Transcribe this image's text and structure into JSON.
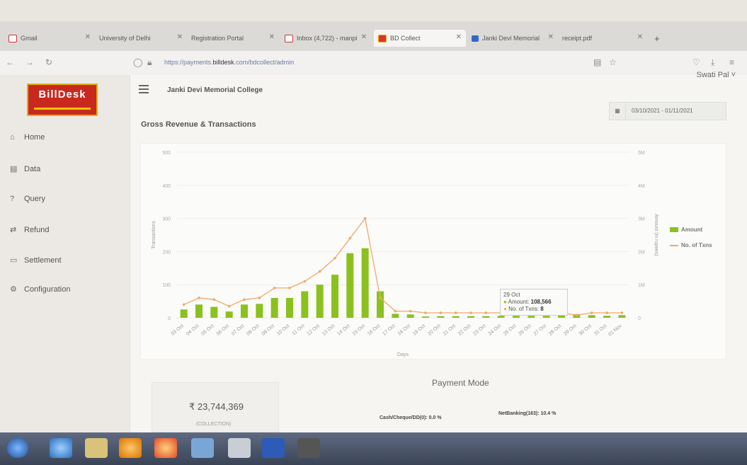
{
  "browser": {
    "tabs": [
      {
        "label": "Gmail",
        "active": false
      },
      {
        "label": "University of Delhi",
        "active": false
      },
      {
        "label": "Registration Portal",
        "active": false
      },
      {
        "label": "Inbox (4,722) - manpi",
        "active": false
      },
      {
        "label": "BD Collect",
        "active": true
      },
      {
        "label": "Janki Devi Memorial",
        "active": false
      },
      {
        "label": "receipt.pdf",
        "active": false
      }
    ],
    "url_prefix": "https://payments.",
    "url_domain": "billdesk",
    "url_suffix": ".com/bdcollect/admin"
  },
  "sidebar": {
    "logo_text": "BillDesk",
    "items": [
      {
        "label": "Home",
        "icon": "home-icon"
      },
      {
        "label": "Data",
        "icon": "document-icon"
      },
      {
        "label": "Query",
        "icon": "question-icon"
      },
      {
        "label": "Refund",
        "icon": "refund-arrows-icon"
      },
      {
        "label": "Settlement",
        "icon": "settlement-icon"
      },
      {
        "label": "Configuration",
        "icon": "gear-icon"
      }
    ]
  },
  "header": {
    "college": "Janki Devi Memorial College",
    "user": "Swati Pal ˅",
    "date_range": "03/10/2021 - 01/11/2021"
  },
  "section_title": "Gross Revenue & Transactions",
  "chart_data": {
    "type": "bar",
    "categories": [
      "03 Oct",
      "04 Oct",
      "05 Oct",
      "06 Oct",
      "07 Oct",
      "08 Oct",
      "09 Oct",
      "10 Oct",
      "11 Oct",
      "12 Oct",
      "13 Oct",
      "14 Oct",
      "15 Oct",
      "16 Oct",
      "17 Oct",
      "18 Oct",
      "19 Oct",
      "20 Oct",
      "21 Oct",
      "22 Oct",
      "23 Oct",
      "24 Oct",
      "25 Oct",
      "26 Oct",
      "27 Oct",
      "28 Oct",
      "29 Oct",
      "30 Oct",
      "31 Oct",
      "01 Nov"
    ],
    "series": [
      {
        "name": "Amount",
        "axis": "right",
        "values": [
          250000,
          400000,
          330000,
          190000,
          400000,
          420000,
          600000,
          600000,
          800000,
          1000000,
          1300000,
          1950000,
          2100000,
          800000,
          120000,
          100000,
          40000,
          50000,
          50000,
          50000,
          50000,
          60000,
          60000,
          60000,
          60000,
          70000,
          108566,
          80000,
          60000,
          80000
        ]
      },
      {
        "name": "No. of Txns",
        "axis": "left",
        "values": [
          40,
          60,
          55,
          35,
          55,
          60,
          90,
          90,
          110,
          140,
          180,
          240,
          300,
          60,
          20,
          20,
          15,
          15,
          15,
          15,
          15,
          15,
          15,
          15,
          15,
          15,
          8,
          15,
          15,
          15
        ]
      }
    ],
    "ylabel_left": "Transactions",
    "ylabel_right": "Amount (in rupees)",
    "xlabel": "Days",
    "ylim_left": [
      0,
      500
    ],
    "ylim_right": [
      0,
      5000000
    ],
    "yticks_left": [
      "0",
      "100",
      "200",
      "300",
      "400",
      "500"
    ],
    "yticks_right": [
      "0",
      "1M",
      "2M",
      "3M",
      "4M",
      "5M"
    ],
    "legend": "right",
    "colors": {
      "amount": "#8ac11e",
      "txns": "#f0a868"
    },
    "tooltip": {
      "date": "29 Oct",
      "amount_label": "Amount:",
      "amount": "108,566",
      "txns_label": "No. of Txns:",
      "txns": "8"
    }
  },
  "payment_mode": {
    "title": "Payment Mode",
    "collection_value": "₹ 23,744,369",
    "collection_label": "(COLLECTION)",
    "labels": [
      "Cash/Cheque/DD(0): 0.0 %",
      "NetBanking(163): 10.4 %"
    ]
  },
  "colors": {
    "accent": "#8ac11e",
    "logo_red": "#c8281e"
  }
}
